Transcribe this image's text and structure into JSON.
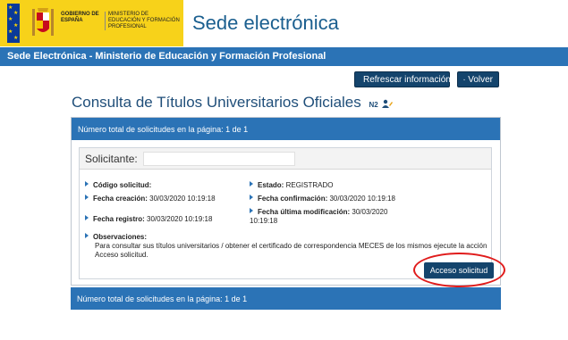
{
  "header": {
    "gov_label": "GOBIERNO DE ESPAÑA",
    "ministry_label": "MINISTERIO DE EDUCACIÓN Y FORMACIÓN PROFESIONAL",
    "site_title": "Sede electrónica"
  },
  "bar": {
    "text": "Sede Electrónica - Ministerio de Educación y Formación Profesional"
  },
  "toolbar": {
    "refresh_label": "Refrescar información",
    "back_label": "Volver"
  },
  "page": {
    "title": "Consulta de Títulos Universitarios Oficiales",
    "badge": "N2"
  },
  "panel": {
    "header": "Número total de solicitudes en la página: 1 de 1",
    "footer": "Número total de solicitudes en la página: 1 de 1"
  },
  "request": {
    "applicant_label": "Solicitante:",
    "applicant_value": "",
    "code_label": "Código solicitud:",
    "code_value": "",
    "created_label": "Fecha creación:",
    "created_value": "30/03/2020 10:19:18",
    "registered_label": "Fecha registro:",
    "registered_value": "30/03/2020 10:19:18",
    "status_label": "Estado:",
    "status_value": "REGISTRADO",
    "confirmed_label": "Fecha confirmación:",
    "confirmed_value": "30/03/2020 10:19:18",
    "modified_label": "Fecha última modificación:",
    "modified_value": "30/03/2020 10:19:18",
    "observations_label": "Observaciones:",
    "observations_text": "Para consultar sus títulos universitarios / obtener el certificado de correspondencia MECES de los mismos ejecute la acción Acceso solicitud.",
    "access_button": "Acceso solicitud"
  },
  "colors": {
    "primary": "#2b73b6",
    "button": "#14446c",
    "highlight": "#e01b1b",
    "gov_yellow": "#f7d21a"
  }
}
